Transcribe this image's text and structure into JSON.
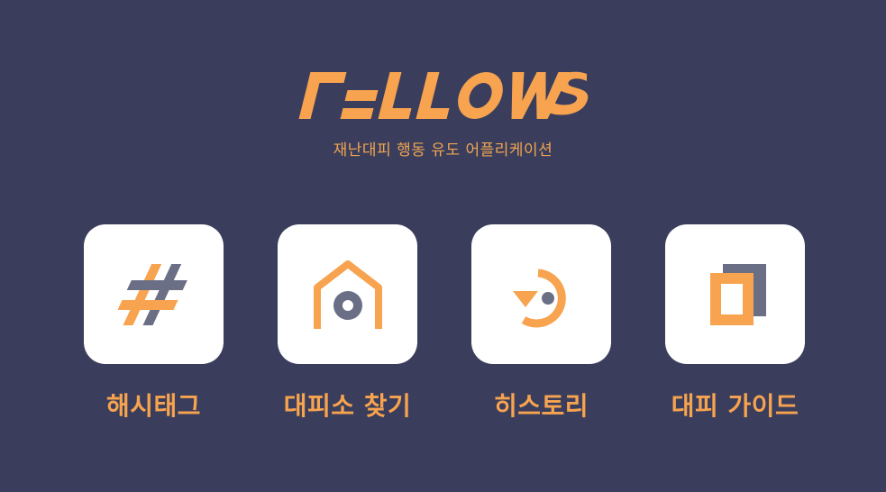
{
  "app": {
    "logo_text": "FELLOWS",
    "subtitle": "재난대피 행동 유도 어플리케이션"
  },
  "colors": {
    "background": "#3a3e5c",
    "accent": "#f7a34f",
    "icon_secondary": "#6b6f86",
    "tile": "#ffffff"
  },
  "menu": {
    "items": [
      {
        "label": "해시태그",
        "icon": "hashtag-icon"
      },
      {
        "label": "대피소 찾기",
        "icon": "shelter-icon"
      },
      {
        "label": "히스토리",
        "icon": "history-icon"
      },
      {
        "label": "대피 가이드",
        "icon": "guide-icon"
      }
    ]
  }
}
